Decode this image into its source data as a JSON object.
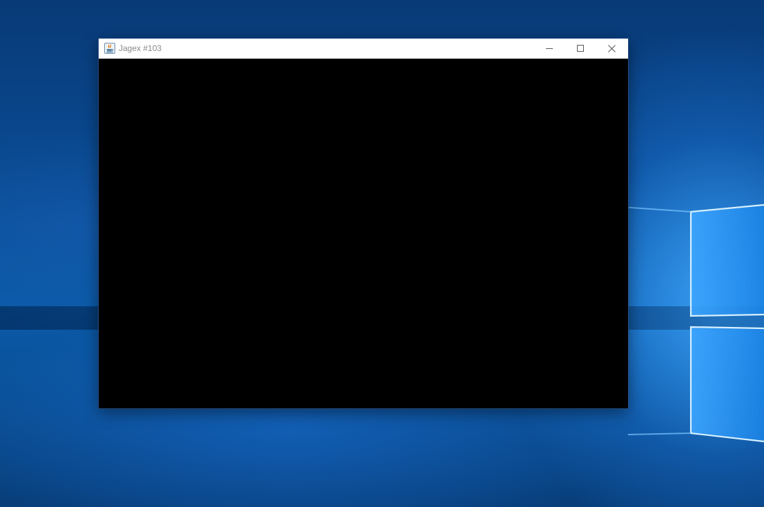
{
  "window": {
    "title": "Jagex #103",
    "icon": "java-app-icon",
    "controls": {
      "minimize_icon": "minimize-icon",
      "maximize_icon": "maximize-icon",
      "close_icon": "close-icon"
    }
  },
  "desktop": {
    "wallpaper": "windows-10-hero-wallpaper"
  },
  "colors": {
    "titlebar": "#ffffff",
    "title_text": "#8a8a8a",
    "client_area": "#000000",
    "desktop_base": "#0a4b93",
    "desktop_glow": "#40aaff"
  }
}
